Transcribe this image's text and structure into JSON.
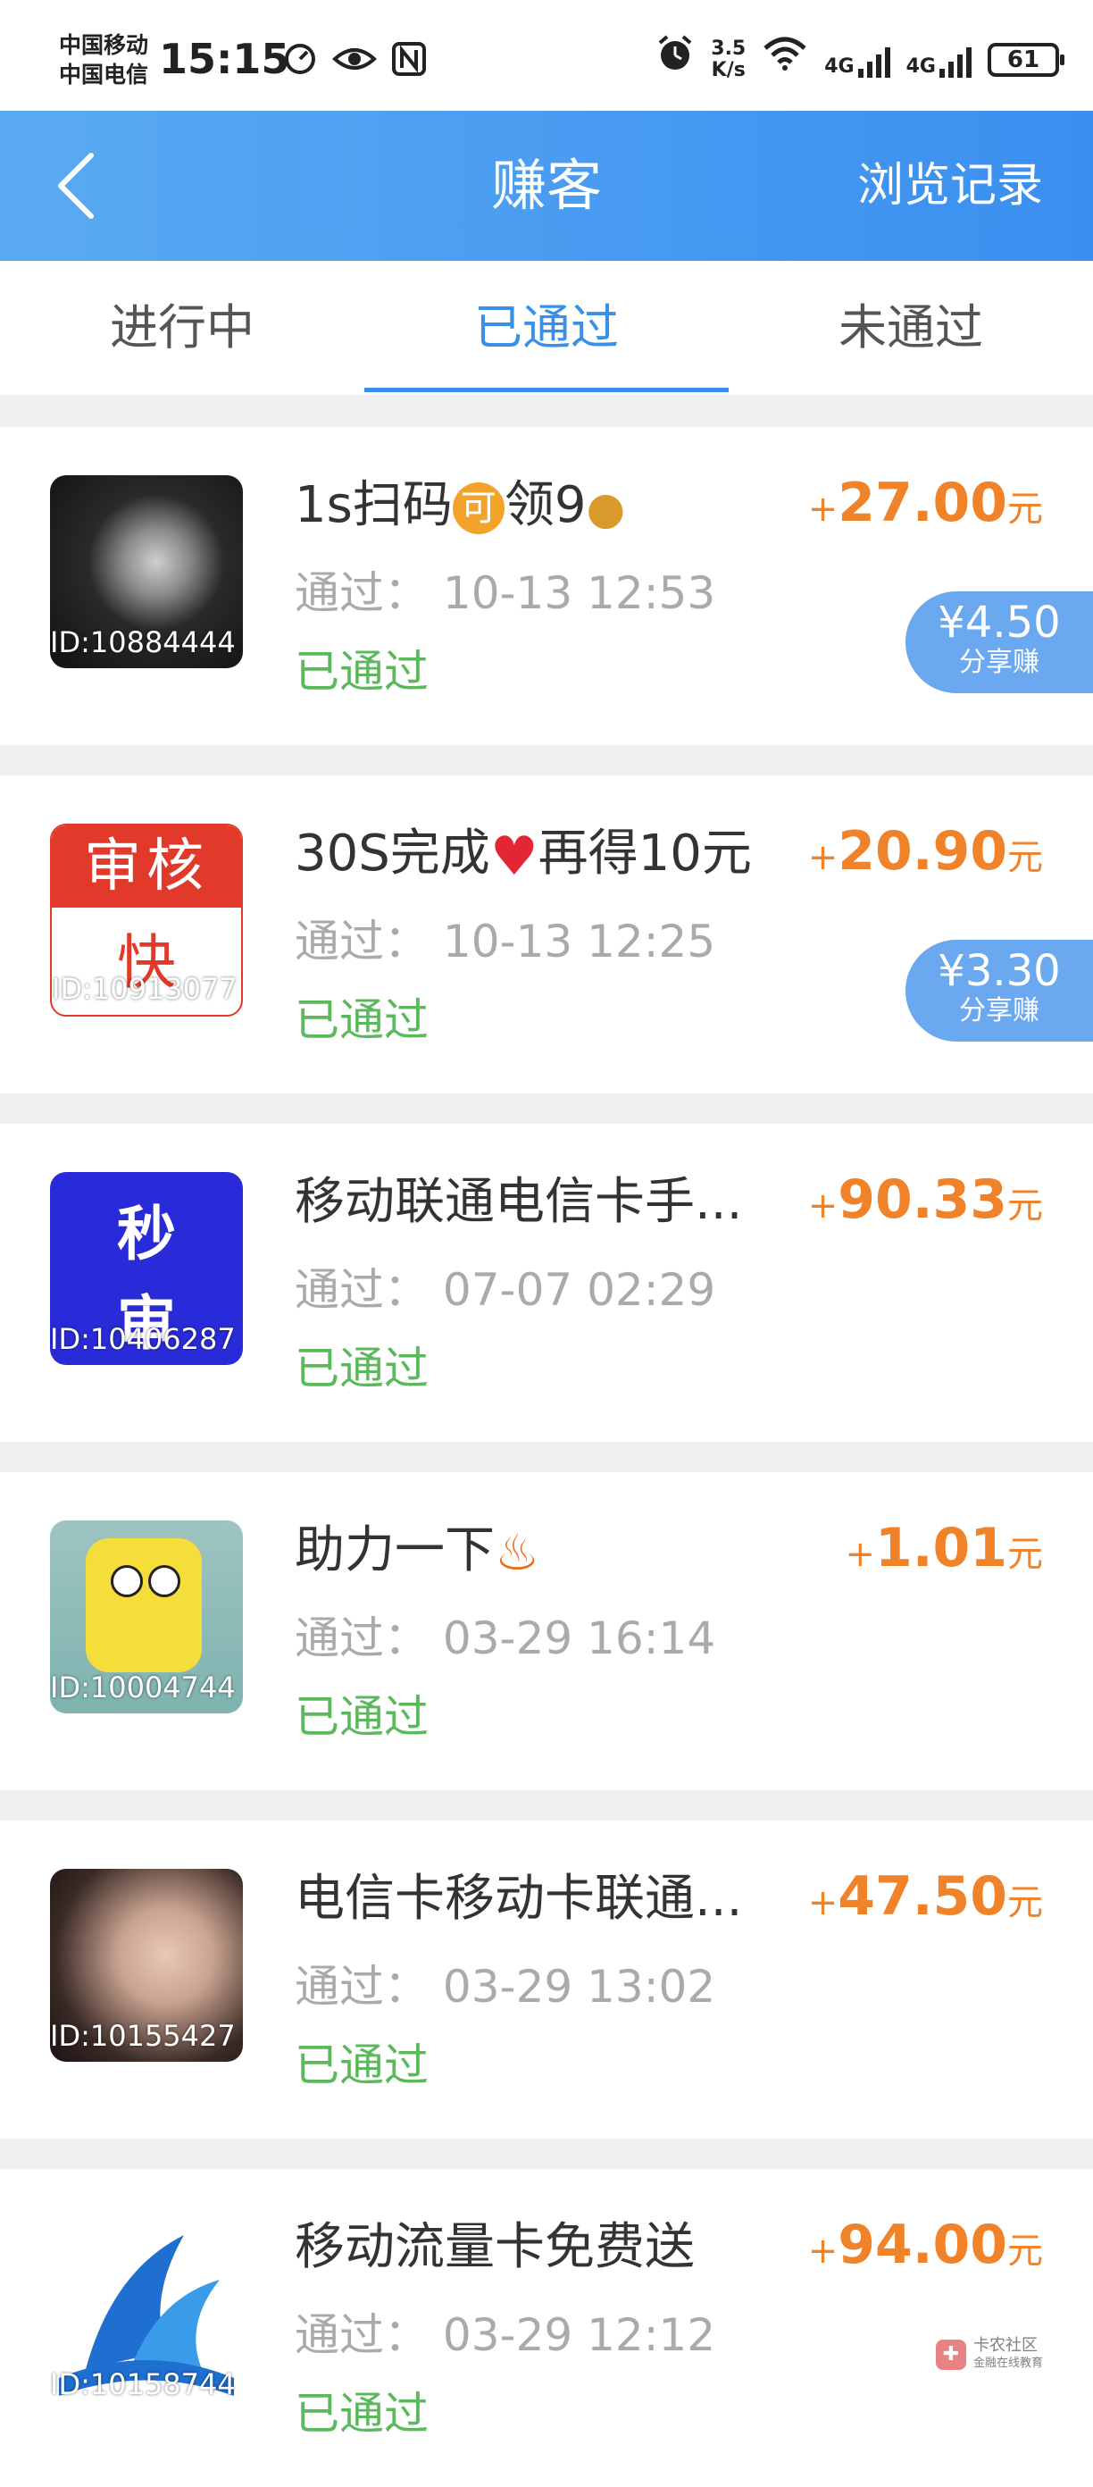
{
  "status_bar": {
    "carrier1": "中国移动",
    "carrier2": "中国电信",
    "time": "15:15",
    "net_speed_value": "3.5",
    "net_speed_unit": "K/s",
    "sig1": "4G",
    "sig2": "4G",
    "battery": "61"
  },
  "header": {
    "title": "赚客",
    "history": "浏览记录"
  },
  "tabs": [
    {
      "label": "进行中"
    },
    {
      "label": "已通过"
    },
    {
      "label": "未通过"
    }
  ],
  "active_tab": 1,
  "items": [
    {
      "name": "1s扫码",
      "name_suffix": "领9",
      "id": "ID:10884444",
      "time_label": "通过：",
      "time": "10-13 12:53",
      "status": "已通过",
      "amount_plus": "+",
      "amount": "27.00",
      "unit": "元",
      "share_amount": "¥4.50",
      "share_label": "分享赚"
    },
    {
      "name": "30S完成",
      "name_suffix": "再得10元",
      "id": "ID:10913077",
      "time_label": "通过：",
      "time": "10-13 12:25",
      "status": "已通过",
      "amount_plus": "+",
      "amount": "20.90",
      "unit": "元",
      "share_amount": "¥3.30",
      "share_label": "分享赚"
    },
    {
      "name": "移动联通电信卡手...",
      "id": "ID:10406287",
      "time_label": "通过：",
      "time": "07-07 02:29",
      "status": "已通过",
      "amount_plus": "+",
      "amount": "90.33",
      "unit": "元",
      "thumb_text1": "秒",
      "thumb_text2": "审"
    },
    {
      "name": "助力一下",
      "id": "ID:10004744",
      "time_label": "通过：",
      "time": "03-29 16:14",
      "status": "已通过",
      "amount_plus": "+",
      "amount": "1.01",
      "unit": "元"
    },
    {
      "name": "电信卡移动卡联通...",
      "id": "ID:10155427",
      "time_label": "通过：",
      "time": "03-29 13:02",
      "status": "已通过",
      "amount_plus": "+",
      "amount": "47.50",
      "unit": "元"
    },
    {
      "name": "移动流量卡免费送",
      "id": "ID:10158744",
      "time_label": "通过：",
      "time": "03-29 12:12",
      "status": "已通过",
      "amount_plus": "+",
      "amount": "94.00",
      "unit": "元"
    }
  ],
  "thumb_labels": {
    "shen": "审",
    "he": "核",
    "kuai": "快"
  },
  "watermark": {
    "title": "卡农社区",
    "sub": "金融在线教育"
  },
  "colors": {
    "header": "#3a8ff0",
    "active_tab": "#3a90e8",
    "amount": "#f0822a",
    "status": "#5cb85c",
    "share_badge": "#6aa8ef"
  }
}
